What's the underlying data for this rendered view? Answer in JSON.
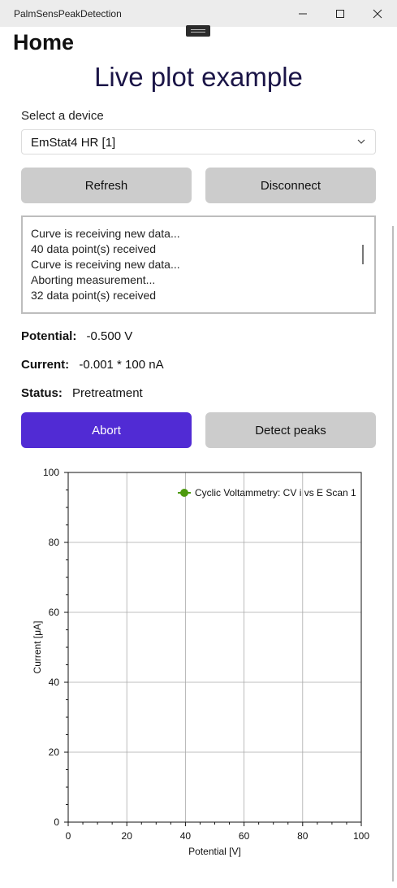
{
  "window": {
    "title": "PalmSensPeakDetection",
    "minimize_icon": "minimize-icon",
    "maximize_icon": "maximize-icon",
    "close_icon": "close-icon"
  },
  "page": {
    "title": "Home",
    "heading": "Live plot example"
  },
  "device": {
    "label": "Select a device",
    "selected": "EmStat4 HR [1]"
  },
  "buttons": {
    "refresh": "Refresh",
    "disconnect": "Disconnect",
    "abort": "Abort",
    "detect_peaks": "Detect peaks"
  },
  "log": {
    "lines": [
      "Curve is receiving new data...",
      "40 data point(s) received",
      "Curve is receiving new data...",
      "Aborting measurement...",
      "32 data point(s) received"
    ]
  },
  "readings": {
    "potential_label": "Potential:",
    "potential_value": "-0.500 V",
    "current_label": "Current:",
    "current_value": "-0.001 * 100 nA",
    "status_label": "Status:",
    "status_value": "Pretreatment"
  },
  "colors": {
    "accent": "#512bd4",
    "series": "#4d9a0e",
    "heading": "#1b1547"
  },
  "chart_data": {
    "type": "line",
    "xlabel": "Potential [V]",
    "ylabel": "Current [μA]",
    "xlim": [
      0,
      100
    ],
    "ylim": [
      0,
      100
    ],
    "x_ticks": [
      0,
      20,
      40,
      60,
      80,
      100
    ],
    "y_ticks": [
      0,
      20,
      40,
      60,
      80,
      100
    ],
    "grid": true,
    "legend_position": "top-right",
    "series": [
      {
        "name": "Cyclic Voltammetry: CV i vs E Scan 1",
        "x": [],
        "y": []
      }
    ]
  }
}
